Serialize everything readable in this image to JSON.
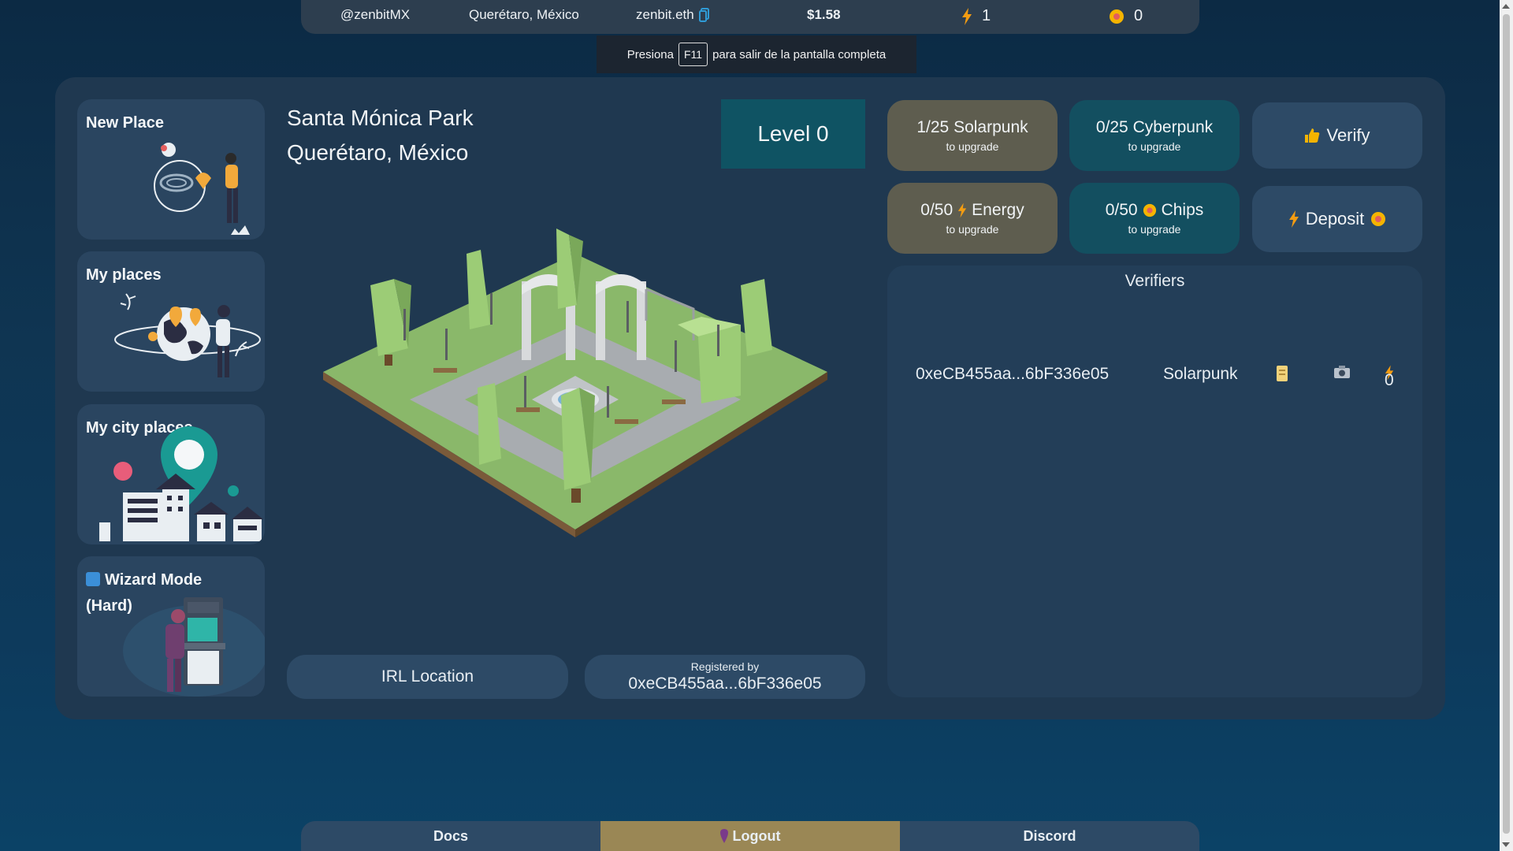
{
  "topbar": {
    "username": "@zenbitMX",
    "location": "Querétaro, México",
    "ens": "zenbit.eth",
    "balance": "$1.58",
    "energy": "1",
    "chips": "0"
  },
  "toast": {
    "before": "Presiona",
    "key": "F11",
    "after": "para salir de la pantalla completa"
  },
  "sidebar": {
    "cards": [
      {
        "title": "New Place"
      },
      {
        "title": "My places"
      },
      {
        "title": "My city places"
      },
      {
        "title": "Wizard Mode (Hard)"
      }
    ]
  },
  "place": {
    "name": "Santa Mónica Park",
    "city": "Querétaro, México",
    "level": "Level 0",
    "irl_button": "IRL Location",
    "registered_label": "Registered by",
    "registered_address": "0xeCB455aa...6bF336e05"
  },
  "stats": {
    "solarpunk": {
      "main": "1/25 Solarpunk",
      "sub": "to upgrade"
    },
    "cyberpunk": {
      "main": "0/25 Cyberpunk",
      "sub": "to upgrade"
    },
    "energy": {
      "count": "0/50",
      "label": "Energy",
      "sub": "to upgrade"
    },
    "chips": {
      "count": "0/50",
      "label": "Chips",
      "sub": "to upgrade"
    },
    "verify": "Verify",
    "deposit": "Deposit"
  },
  "verifiers": {
    "title": "Verifiers",
    "rows": [
      {
        "address": "0xeCB455aa...6bF336e05",
        "type": "Solarpunk",
        "energy": "0"
      }
    ]
  },
  "footer": {
    "docs": "Docs",
    "logout": "Logout",
    "discord": "Discord"
  },
  "colors": {
    "energy": "#f39c12",
    "chip": "#f5b400",
    "logout_bg": "#9a8755"
  }
}
